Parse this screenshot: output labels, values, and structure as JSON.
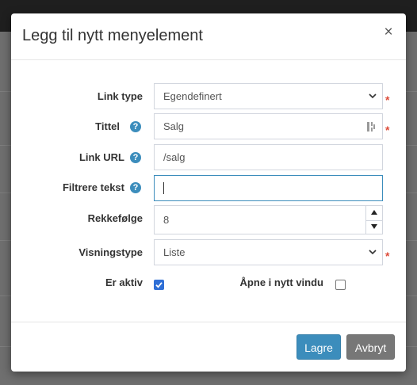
{
  "modal": {
    "title": "Legg til nytt menyelement",
    "close_symbol": "×"
  },
  "form": {
    "link_type": {
      "label": "Link type",
      "value": "Egendefinert",
      "required": true
    },
    "title": {
      "label": "Tittel",
      "value": "Salg",
      "required": true,
      "help_icon": "question-circle-icon"
    },
    "link_url": {
      "label": "Link URL",
      "value": "/salg",
      "help_icon": "question-circle-icon"
    },
    "filter_text": {
      "label": "Filtrere tekst",
      "value": "",
      "help_icon": "question-circle-icon"
    },
    "order": {
      "label": "Rekkefølge",
      "value": "8"
    },
    "display_type": {
      "label": "Visningstype",
      "value": "Liste",
      "required": true
    },
    "is_active": {
      "label": "Er aktiv",
      "checked": true
    },
    "open_new_window": {
      "label": "Åpne i nytt vindu",
      "checked": false
    },
    "required_marker": "*",
    "help_symbol": "?"
  },
  "footer": {
    "save_label": "Lagre",
    "cancel_label": "Avbryt"
  },
  "colors": {
    "primary": "#3c8dbc",
    "required": "#dd4b39",
    "cancel": "#777777",
    "checkbox": "#2f6fd6"
  }
}
